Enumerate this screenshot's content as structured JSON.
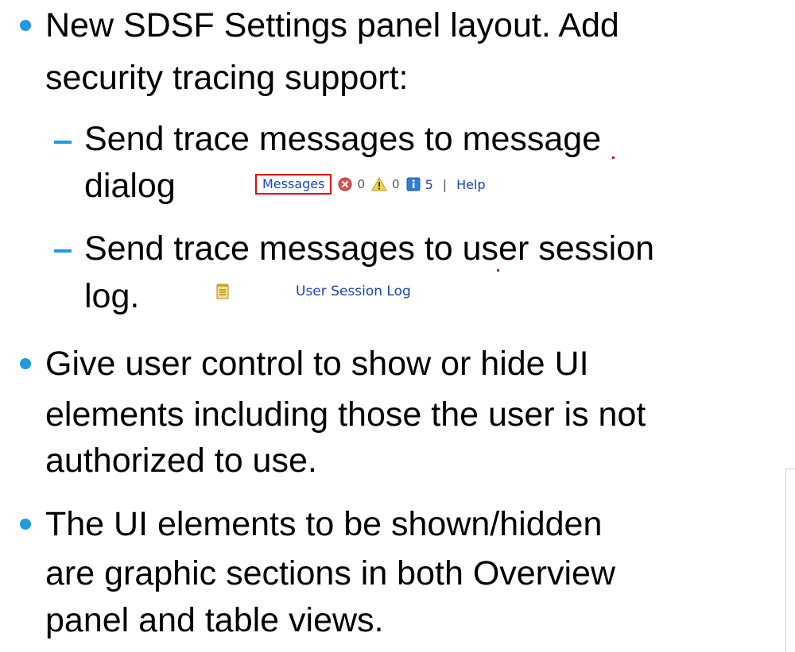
{
  "bullets": {
    "b1_line1": "New SDSF Settings panel layout. Add",
    "b1_line2": "security tracing support:",
    "sub1_line1": "Send trace messages to message",
    "sub1_line2": "dialog",
    "sub2_line1": "Send trace messages to user session",
    "sub2_line2": "log.",
    "b2_line1": "Give user control to show or hide UI",
    "b2_line2": "elements including those the user is not",
    "b2_line3": "authorized to use.",
    "b3_line1": "The UI elements to be shown/hidden",
    "b3_line2": "are graphic sections in both Overview",
    "b3_line3": "panel and table views."
  },
  "message_bar": {
    "messages_label": "Messages",
    "error_count": "0",
    "warning_count": "0",
    "info_count": "5",
    "separator": "|",
    "help_label": "Help"
  },
  "session_log": {
    "label": "User Session Log"
  },
  "colors": {
    "bullet": "#1f9be0",
    "link": "#1a45b8",
    "highlight_border": "#e01010"
  },
  "icons": {
    "error": "error-circle-icon",
    "warning": "warning-triangle-icon",
    "info": "info-square-icon",
    "log": "notepad-icon"
  }
}
